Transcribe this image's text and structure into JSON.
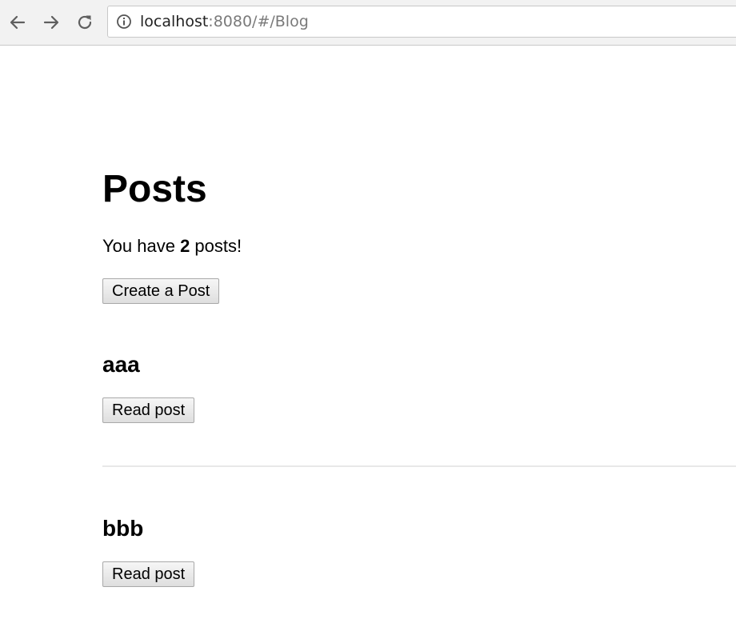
{
  "browser": {
    "url_host": "localhost",
    "url_rest": ":8080/#/Blog",
    "icons": {
      "back": "back-arrow-icon",
      "forward": "forward-arrow-icon",
      "reload": "reload-icon",
      "info": "info-icon"
    }
  },
  "page": {
    "title": "Posts",
    "count_prefix": "You have ",
    "count_value": "2",
    "count_suffix": " posts!",
    "create_label": "Create a Post"
  },
  "posts": [
    {
      "title": "aaa",
      "read_label": "Read post"
    },
    {
      "title": "bbb",
      "read_label": "Read post"
    }
  ]
}
